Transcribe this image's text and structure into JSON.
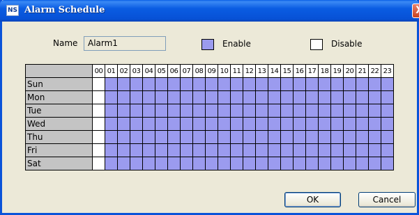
{
  "window": {
    "title": "Alarm Schedule",
    "app_icon_text": "NS",
    "close_glyph": "X"
  },
  "form": {
    "name_label": "Name",
    "name_value": "Alarm1"
  },
  "legend": {
    "enable_label": "Enable",
    "disable_label": "Disable",
    "enable_color": "#9b9bef",
    "disable_color": "#ffffff"
  },
  "schedule": {
    "hours": [
      "00",
      "01",
      "02",
      "03",
      "04",
      "05",
      "06",
      "07",
      "08",
      "09",
      "10",
      "11",
      "12",
      "13",
      "14",
      "15",
      "16",
      "17",
      "18",
      "19",
      "20",
      "21",
      "22",
      "23"
    ],
    "days": [
      {
        "label": "Sun",
        "disabled_hours": [
          "00"
        ]
      },
      {
        "label": "Mon",
        "disabled_hours": [
          "00"
        ]
      },
      {
        "label": "Tue",
        "disabled_hours": [
          "00"
        ]
      },
      {
        "label": "Wed",
        "disabled_hours": [
          "00"
        ]
      },
      {
        "label": "Thu",
        "disabled_hours": [
          "00"
        ]
      },
      {
        "label": "Fri",
        "disabled_hours": [
          "00"
        ]
      },
      {
        "label": "Sat",
        "disabled_hours": [
          "00"
        ]
      }
    ]
  },
  "buttons": {
    "ok_label": "OK",
    "cancel_label": "Cancel"
  }
}
